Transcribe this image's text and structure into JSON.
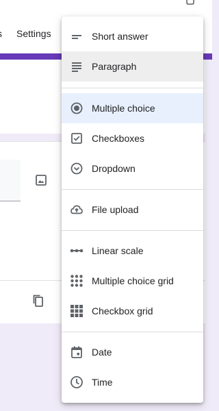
{
  "colors": {
    "accent": "#673ab7",
    "background": "#f0ebf8",
    "selected_bg": "#e8f0fe",
    "hover_bg": "#eeeeee"
  },
  "header": {
    "partial_tab": "s",
    "settings_tab": "Settings"
  },
  "menu": {
    "items": [
      {
        "label": "Short answer",
        "icon": "short-answer-icon"
      },
      {
        "label": "Paragraph",
        "icon": "paragraph-icon",
        "state": "hover"
      },
      {
        "label": "Multiple choice",
        "icon": "radio-button-icon",
        "state": "selected"
      },
      {
        "label": "Checkboxes",
        "icon": "checkbox-icon"
      },
      {
        "label": "Dropdown",
        "icon": "dropdown-circle-icon"
      },
      {
        "label": "File upload",
        "icon": "cloud-upload-icon"
      },
      {
        "label": "Linear scale",
        "icon": "linear-scale-icon"
      },
      {
        "label": "Multiple choice grid",
        "icon": "dot-grid-icon"
      },
      {
        "label": "Checkbox grid",
        "icon": "square-grid-icon"
      },
      {
        "label": "Date",
        "icon": "calendar-icon"
      },
      {
        "label": "Time",
        "icon": "clock-icon"
      }
    ]
  }
}
